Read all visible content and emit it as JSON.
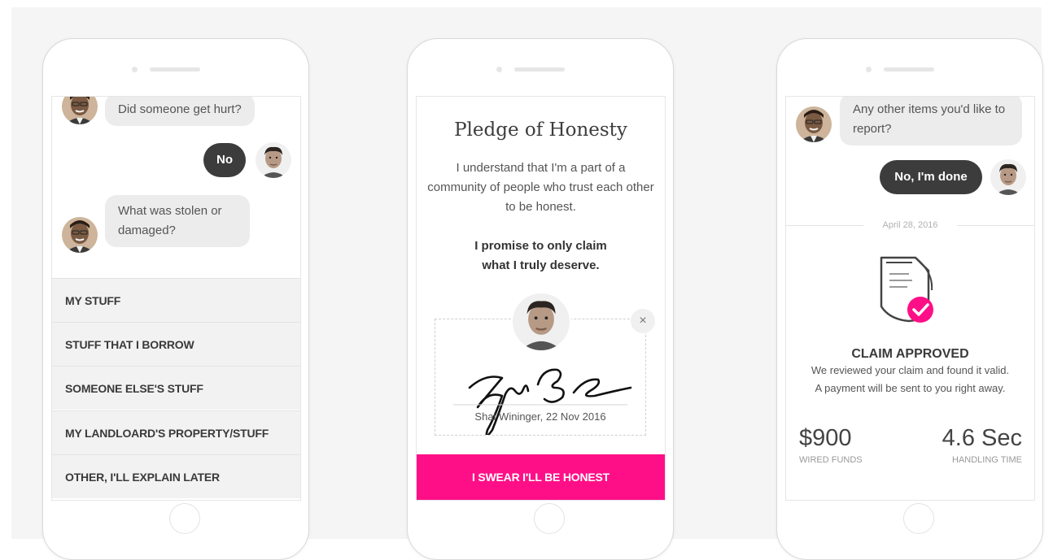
{
  "colors": {
    "pink": "#ff0f87",
    "dark_bubble": "#3c3c3c",
    "light_bubble": "#ececec"
  },
  "phone1": {
    "messages": [
      {
        "from": "bot",
        "text": "Did someone get hurt?"
      },
      {
        "from": "user",
        "text": "No"
      },
      {
        "from": "bot",
        "text": "What was stolen or damaged?"
      }
    ],
    "options": [
      "MY STUFF",
      "STUFF THAT I BORROW",
      "SOMEONE ELSE'S STUFF",
      "MY LANDLOARD'S PROPERTY/STUFF",
      "OTHER, I'LL EXPLAIN LATER"
    ]
  },
  "phone2": {
    "title": "Pledge of Honesty",
    "body": "I understand that I'm a part of a community of people who trust each other to be honest.",
    "promise": "I promise to only claim what I truly deserve.",
    "close_icon": "×",
    "signature_caption": "Shai Wininger, 22 Nov 2016",
    "button": "I SWEAR I'LL BE HONEST"
  },
  "phone3": {
    "messages": [
      {
        "from": "bot",
        "text": "Any other items you'd like to report?"
      },
      {
        "from": "user",
        "text": "No, I'm done"
      }
    ],
    "date": "April 28, 2016",
    "status_title": "CLAIM APPROVED",
    "status_text": "We reviewed your claim and found it valid. A payment will be sent to you right away.",
    "stats": [
      {
        "value": "$900",
        "label": "WIRED FUNDS"
      },
      {
        "value": "4.6 Sec",
        "label": "HANDLING TIME"
      }
    ]
  }
}
